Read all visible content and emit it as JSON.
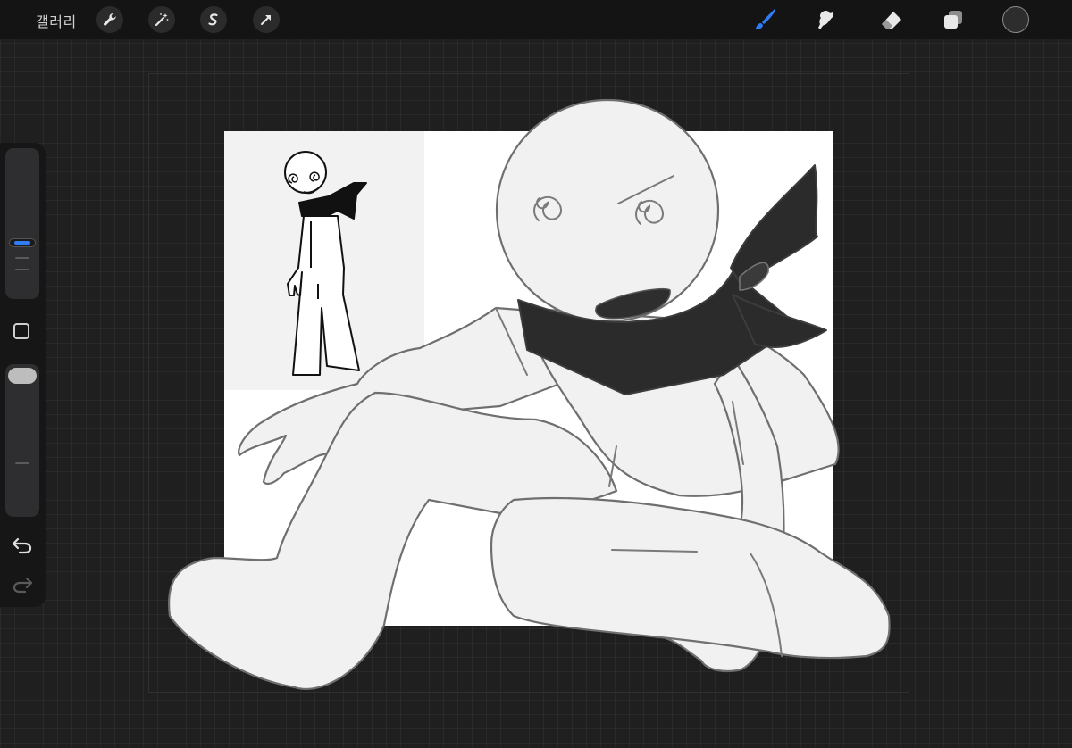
{
  "topbar": {
    "gallery_label": "갤러리",
    "actions": [
      "wrench-icon",
      "magic-wand-icon",
      "selection-s-icon",
      "transform-arrow-icon"
    ],
    "tools": [
      "brush-icon",
      "smudge-icon",
      "eraser-icon",
      "layers-icon"
    ],
    "active_tool": "brush-icon",
    "active_color": "#2d2d2e",
    "accent_color": "#2f7cf5"
  },
  "sidebar": {
    "brush_size_level": 0.6,
    "opacity_level": 1.0,
    "buttons": [
      "modify-square-icon",
      "undo-icon",
      "redo-icon"
    ]
  },
  "canvas": {
    "background": "#ffffff",
    "grid": "on"
  }
}
